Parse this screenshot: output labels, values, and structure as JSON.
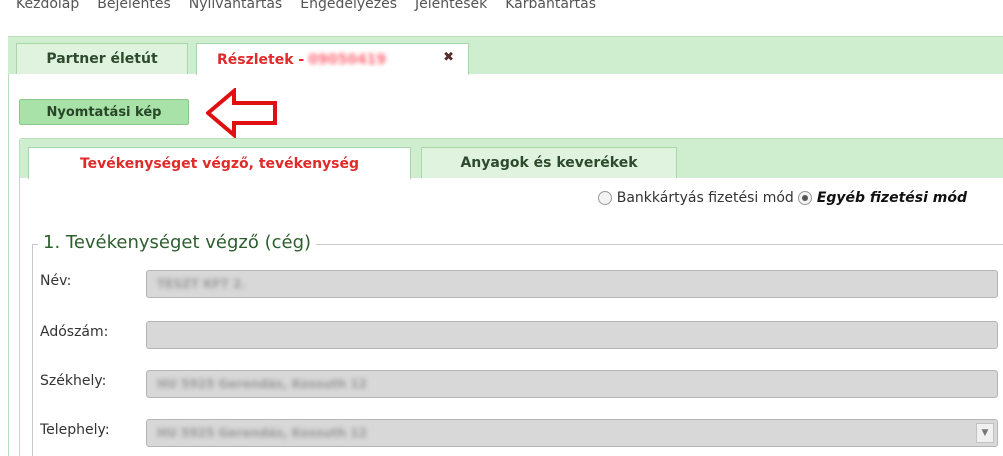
{
  "top_menu": [
    "Kezdőlap",
    "Bejelentés",
    "Nyilvántartás",
    "Engedélyezés",
    "Jelentések",
    "Karbantartás"
  ],
  "outer_tabs": {
    "partner": "Partner életút",
    "details": "Részletek -",
    "details_id": "09050419",
    "close": "✖"
  },
  "print_button": "Nyomtatási kép",
  "inner_tabs": {
    "activity": "Tevékenységet végző, tevékenység",
    "materials": "Anyagok és keverékek"
  },
  "payment": {
    "card_label": "Bankkártyás fizetési mód",
    "other_label": "Egyéb fizetési mód",
    "selected": "other"
  },
  "section": {
    "title": "1. Tevékenységet végző (cég)",
    "fields": [
      {
        "label": "Név:",
        "value": "TESZT KFT 2."
      },
      {
        "label": "Adószám:",
        "value": ""
      },
      {
        "label": "Székhely:",
        "value": "HU 5925 Gerendás, Kossuth 12"
      },
      {
        "label": "Telephely:",
        "value": "HU 5925 Gerendás, Kossuth 12"
      }
    ]
  },
  "colors": {
    "accent_green": "#cfeecf",
    "active_tab_text": "#e02a2a",
    "arrow": "#e01010"
  }
}
